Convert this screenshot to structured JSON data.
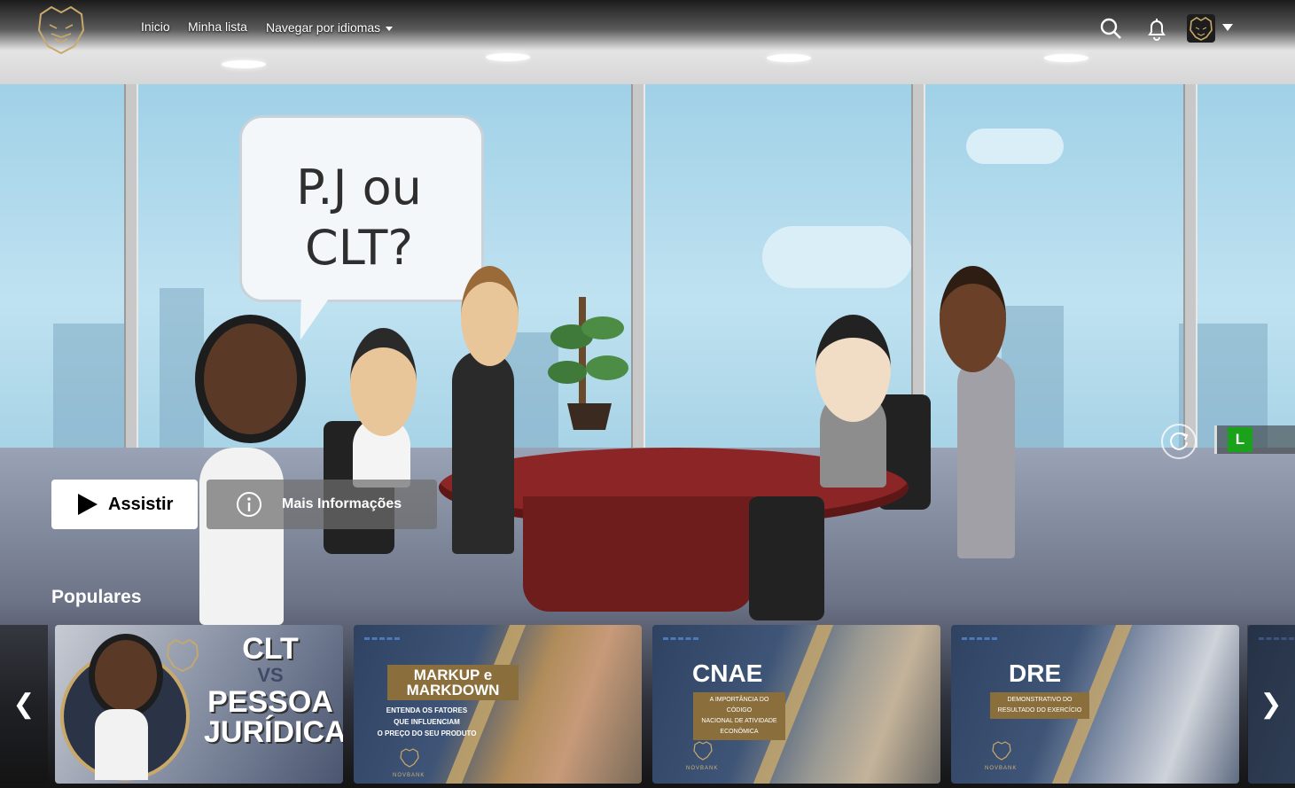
{
  "nav": {
    "links": [
      "Inicio",
      "Minha lista",
      "Navegar por idiomas"
    ]
  },
  "hero": {
    "speech_bubble": [
      "P.J ou",
      "CLT?"
    ],
    "play_label": "Assistir",
    "info_label": "Mais Informações",
    "rating": "L"
  },
  "row": {
    "title": "Populares",
    "prev": "❮",
    "next": "❯",
    "cards": [
      {
        "title_lines": [
          "CLT",
          "VS",
          "PESSOA",
          "JURÍDICA"
        ]
      },
      {
        "title_lines": [
          "MARKUP e",
          "MARKDOWN"
        ],
        "subtitle_lines": [
          "ENTENDA OS FATORES",
          "QUE INFLUENCIAM",
          "O PREÇO DO SEU PRODUTO"
        ],
        "brand": "NOVBANK"
      },
      {
        "title": "CNAE",
        "subtitle_lines": [
          "A IMPORTÂNCIA DO CÓDIGO",
          "NACIONAL DE ATIVIDADE",
          "ECONÔMICA"
        ],
        "brand": "NOVBANK"
      },
      {
        "title": "DRE",
        "subtitle_lines": [
          "DEMONSTRATIVO DO",
          "RESULTADO DO EXERCÍCIO"
        ],
        "brand": "NOVBANK"
      }
    ]
  },
  "colors": {
    "accent_gold": "#c9a96a",
    "rating_green": "#1aa31a",
    "table_red": "#8c2626"
  }
}
